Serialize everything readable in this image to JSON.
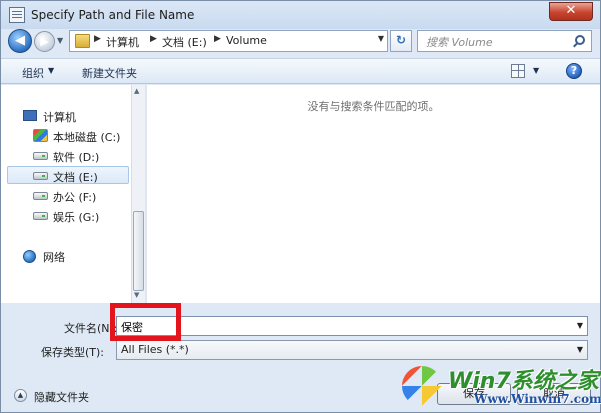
{
  "window": {
    "title": "Specify Path and File Name",
    "close_symbol": "✕"
  },
  "address_bar": {
    "back_symbol": "◀",
    "forward_symbol": "▶",
    "dropdown_symbol": "▼",
    "breadcrumbs": [
      "计算机",
      "文档 (E:)",
      "Volume"
    ],
    "separator": "▶",
    "refresh_symbol": "↻",
    "search_placeholder": "搜索 Volume"
  },
  "toolbar": {
    "organize_label": "组织",
    "organize_caret": "▼",
    "new_folder_label": "新建文件夹",
    "views_caret": "▼",
    "help_symbol": "?"
  },
  "nav_pane": {
    "items": [
      {
        "label": "计算机",
        "icon": "computer-icon"
      },
      {
        "label": "本地磁盘 (C:)",
        "icon": "system-drive-icon"
      },
      {
        "label": "软件 (D:)",
        "icon": "drive-icon"
      },
      {
        "label": "文档 (E:)",
        "icon": "drive-icon",
        "selected": true
      },
      {
        "label": "办公 (F:)",
        "icon": "drive-icon"
      },
      {
        "label": "娱乐 (G:)",
        "icon": "drive-icon"
      },
      {
        "label": "网络",
        "icon": "network-icon"
      }
    ],
    "scroll_up": "▲",
    "scroll_down": "▼"
  },
  "file_pane": {
    "empty_message": "没有与搜索条件匹配的项。"
  },
  "form": {
    "filename_label": "文件名(N):",
    "filename_value": "保密",
    "filetype_label": "保存类型(T):",
    "filetype_value": "All Files (*.*)",
    "dropdown_symbol": "▼",
    "hide_folders_label": "隐藏文件夹",
    "collapse_symbol": "▲",
    "save_button": "保存",
    "cancel_button": "取消"
  },
  "watermark": {
    "title": "Win7系统之家",
    "url": "Www.Winwin7.com"
  },
  "colors": {
    "highlight_box": "#e3141b",
    "window_frame": "#dfe9f5",
    "selection": "#dbe9f9"
  }
}
